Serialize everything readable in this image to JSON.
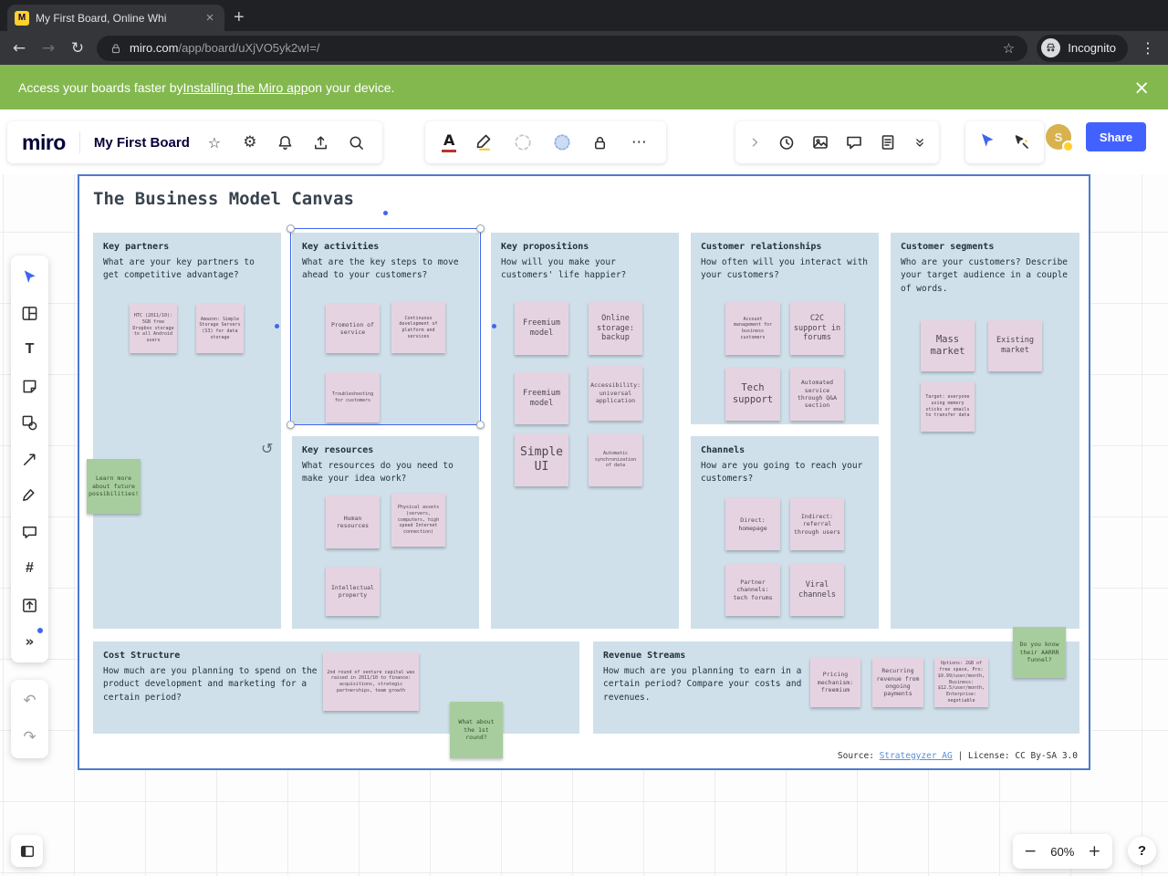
{
  "browser": {
    "tab_title": "My First Board, Online Whi",
    "favicon_letter": "M",
    "close_tab": "×",
    "new_tab": "+",
    "back": "←",
    "forward": "→",
    "reload": "↻",
    "url_domain": "miro.com",
    "url_path": "/app/board/uXjVO5yk2wI=/",
    "bookmark_star": "☆",
    "incognito_label": "Incognito",
    "menu_dots": "⋮"
  },
  "banner": {
    "prefix": "Access your boards faster by ",
    "link": "Installing the Miro app",
    "suffix": " on your device.",
    "close": "×"
  },
  "header": {
    "logo": "miro",
    "board_name": "My First Board",
    "star": "☆",
    "gear": "⚙",
    "text_color_letter": "A",
    "more_dots": "⋯",
    "share": "Share",
    "avatar_initial": "S"
  },
  "sidebar": {
    "text_tool": "T",
    "frame_tool": "#",
    "more_tools": "»",
    "undo": "↶",
    "redo": "↷"
  },
  "controls": {
    "zoom_out": "−",
    "zoom_level": "60%",
    "zoom_in": "+",
    "help": "?"
  },
  "canvas": {
    "title": "The Business Model Canvas",
    "sections": {
      "key_partners": {
        "title": "Key partners",
        "desc": "What are your key partners to get competitive advantage?"
      },
      "key_activities": {
        "title": "Key activities",
        "desc": "What are the key steps to move ahead to your customers?"
      },
      "key_resources": {
        "title": "Key resources",
        "desc": "What resources do you need to make your idea work?"
      },
      "key_propositions": {
        "title": "Key propositions",
        "desc": "How will you make your customers' life happier?"
      },
      "customer_relationships": {
        "title": "Customer relationships",
        "desc": "How often will you interact with your customers?"
      },
      "channels": {
        "title": "Channels",
        "desc": "How are you going to reach your customers?"
      },
      "customer_segments": {
        "title": "Customer segments",
        "desc": "Who are your customers? Describe your target audience in a couple of words."
      },
      "cost_structure": {
        "title": "Cost Structure",
        "desc": "How much are you planning to spend on the product development and marketing for a certain period?"
      },
      "revenue_streams": {
        "title": "Revenue Streams",
        "desc": "How much are you planning to earn in a certain period? Compare your costs and revenues."
      }
    },
    "notes": {
      "kp1": "HTC (2011/10): 5GB free Dropbox storage to all Android users",
      "kp2": "Amazon: Simple Storage Servers (S3) for data storage",
      "kpg": "Learn more about future possibilities!",
      "ka1": "Promotion of service",
      "ka2": "Continuous development of platform and services",
      "ka3": "Troubleshooting for customers",
      "kr1": "Human resources",
      "kr2": "Physical assets (servers, computers, high speed Internet connection)",
      "kr3": "Intellectual property",
      "p1": "Freemium model",
      "p2": "Online storage: backup",
      "p3": "Freemium model",
      "p4": "Accessibility: universal application",
      "p5": "Simple UI",
      "p6": "Automatic synchronization of data",
      "cr1": "Account management for business customers",
      "cr2": "C2C support in forums",
      "cr3": "Tech support",
      "cr4": "Automated service through Q&A section",
      "ch1": "Direct: homepage",
      "ch2": "Indirect: referral through users",
      "ch3": "Partner channels: tech forums",
      "ch4": "Viral channels",
      "cs1": "Mass market",
      "cs2": "Existing market",
      "cs3": "Target: everyone using memory sticks or emails to transfer data",
      "csg": "Do you know their AARRR funnel?",
      "co1": "2nd round of venture capital was raised in 2011/10 to finance: acquisitions, strategic partnerships, team growth",
      "cog": "What about the 1st round?",
      "rv1": "Pricing mechanism: freemium",
      "rv2": "Recurring revenue from ongoing payments",
      "rv3": "Options: 2GB of free space, Pro: $9.99/user/month, Business: $12.5/user/month, Enterprise: negotiable"
    },
    "source": {
      "prefix": "Source: ",
      "link": "Strategyzer AG",
      "suffix": " | License: CC By-SA 3.0"
    }
  }
}
